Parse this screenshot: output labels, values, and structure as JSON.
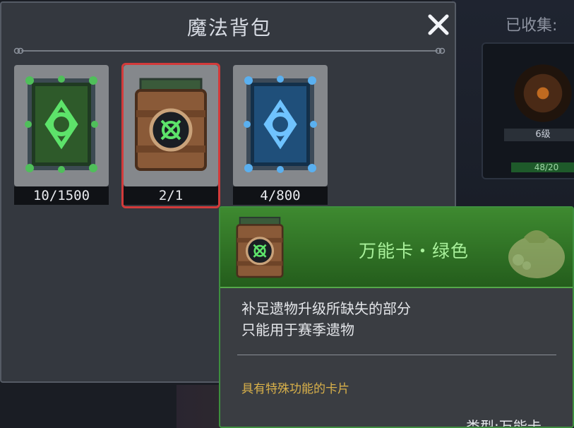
{
  "background": {
    "collected_label": "已收集:",
    "card_level": "6级",
    "card_hp": "48/20"
  },
  "panel": {
    "title": "魔法背包",
    "close_icon": "close-icon"
  },
  "slots": [
    {
      "count": "10/1500",
      "card": "green-card",
      "selected": false
    },
    {
      "count": "2/1",
      "card": "universal-card-green",
      "selected": true
    },
    {
      "count": "4/800",
      "card": "blue-card",
      "selected": false
    }
  ],
  "tooltip": {
    "name": "万能卡・绿色",
    "desc_line1": "补足遗物升级所缺失的部分",
    "desc_line2": "只能用于赛季遗物",
    "flavor": "具有特殊功能的卡片",
    "type": "类型:万能卡"
  },
  "colors": {
    "selected_border": "#d23a3a",
    "tooltip_header": "#3e8a30",
    "tooltip_name": "#a8f09a",
    "flavor_text": "#d9b14a"
  }
}
